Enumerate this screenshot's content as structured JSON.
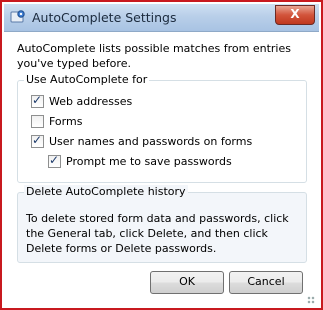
{
  "window": {
    "title": "AutoComplete Settings",
    "close_glyph": "X",
    "app_icon": "settings-app-icon"
  },
  "intro_text": "AutoComplete lists possible matches from entries you've typed before.",
  "use_group": {
    "legend": "Use AutoComplete for",
    "items": [
      {
        "label": "Web addresses",
        "checked": true
      },
      {
        "label": "Forms",
        "checked": false
      },
      {
        "label": "User names and passwords on forms",
        "checked": true
      },
      {
        "label": "Prompt me to save passwords",
        "checked": true
      }
    ]
  },
  "delete_group": {
    "legend": "Delete AutoComplete history",
    "text": "To delete stored form data and passwords, click the General tab, click Delete, and then click Delete forms or Delete passwords."
  },
  "buttons": {
    "ok": "OK",
    "cancel": "Cancel"
  },
  "colors": {
    "frame_border": "#c8191f",
    "close_button": "#c0381e"
  }
}
